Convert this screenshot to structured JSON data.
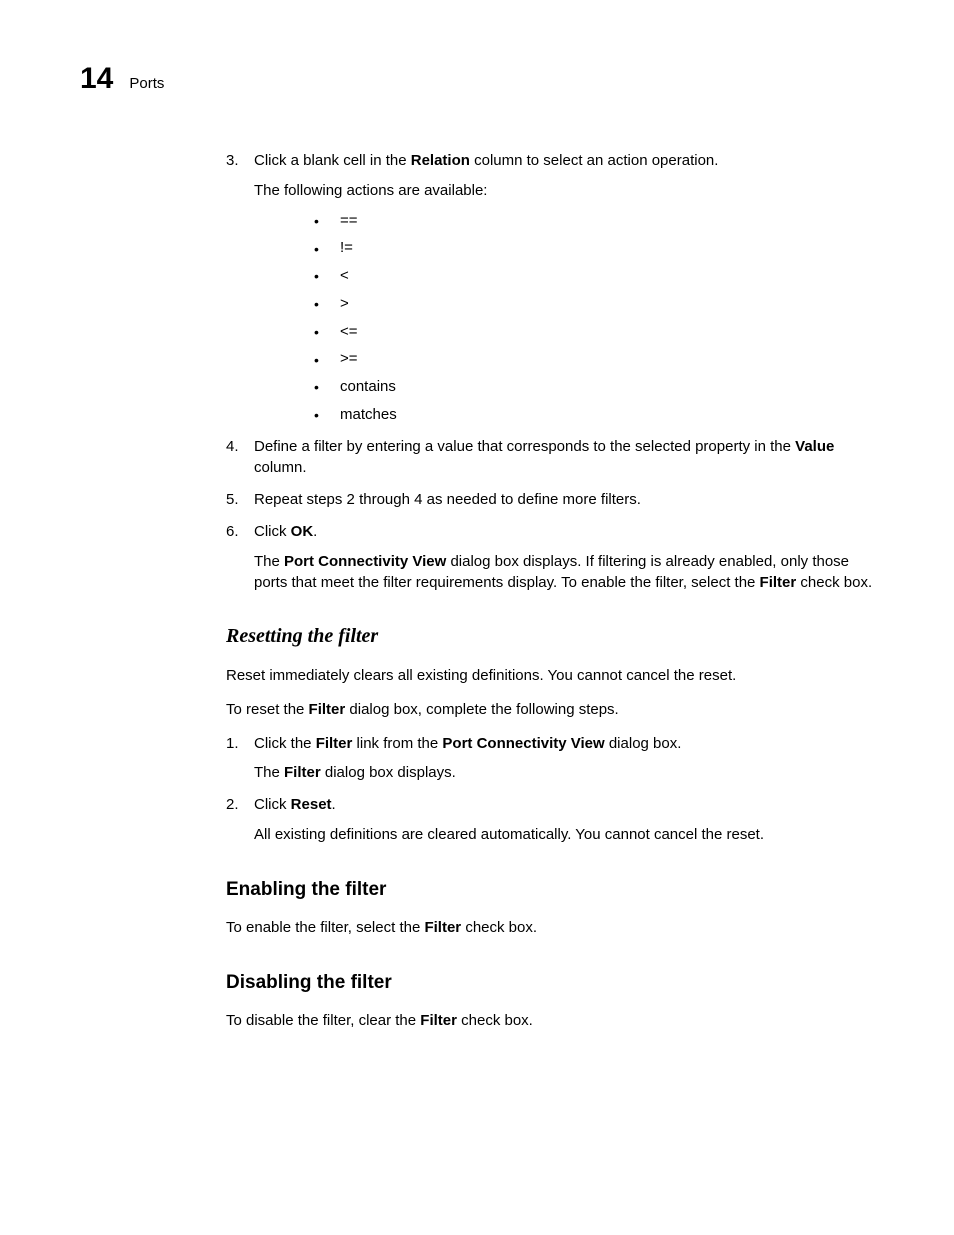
{
  "header": {
    "chapter_number": "14",
    "chapter_title": "Ports"
  },
  "step3": {
    "num": "3.",
    "text_pre": "Click a blank cell in the ",
    "bold1": "Relation",
    "text_post": " column to select an action operation.",
    "sub": "The following actions are available:",
    "bullets": [
      "==",
      "!=",
      "<",
      ">",
      "<=",
      ">=",
      "contains",
      "matches"
    ]
  },
  "step4": {
    "num": "4.",
    "text_pre": "Define a filter by entering a value that corresponds to the selected property in the ",
    "bold1": "Value",
    "text_post": " column."
  },
  "step5": {
    "num": "5.",
    "text": "Repeat steps 2 through 4 as needed to define more filters."
  },
  "step6": {
    "num": "6.",
    "text_pre": "Click ",
    "bold1": "OK",
    "text_post": ".",
    "sub_pre": "The ",
    "sub_b1": "Port Connectivity View",
    "sub_mid": " dialog box displays. If filtering is already enabled, only those ports that meet the filter requirements display. To enable the filter, select the ",
    "sub_b2": "Filter",
    "sub_post": " check box."
  },
  "resetting": {
    "heading": "Resetting the filter",
    "p1": "Reset immediately clears all existing definitions. You cannot cancel the reset.",
    "p2_pre": "To reset the ",
    "p2_b": "Filter",
    "p2_post": " dialog box, complete the following steps.",
    "s1": {
      "num": "1.",
      "pre": "Click the ",
      "b1": "Filter",
      "mid": " link from the ",
      "b2": "Port Connectivity View",
      "post": " dialog box.",
      "sub_pre": "The ",
      "sub_b": "Filter",
      "sub_post": " dialog box displays."
    },
    "s2": {
      "num": "2.",
      "pre": "Click ",
      "b1": "Reset",
      "post": ".",
      "sub": "All existing definitions are cleared automatically. You cannot cancel the reset."
    }
  },
  "enabling": {
    "heading": "Enabling the filter",
    "p_pre": "To enable the filter, select the ",
    "p_b": "Filter",
    "p_post": " check box."
  },
  "disabling": {
    "heading": "Disabling the filter",
    "p_pre": "To disable the filter, clear the ",
    "p_b": "Filter",
    "p_post": " check box."
  }
}
